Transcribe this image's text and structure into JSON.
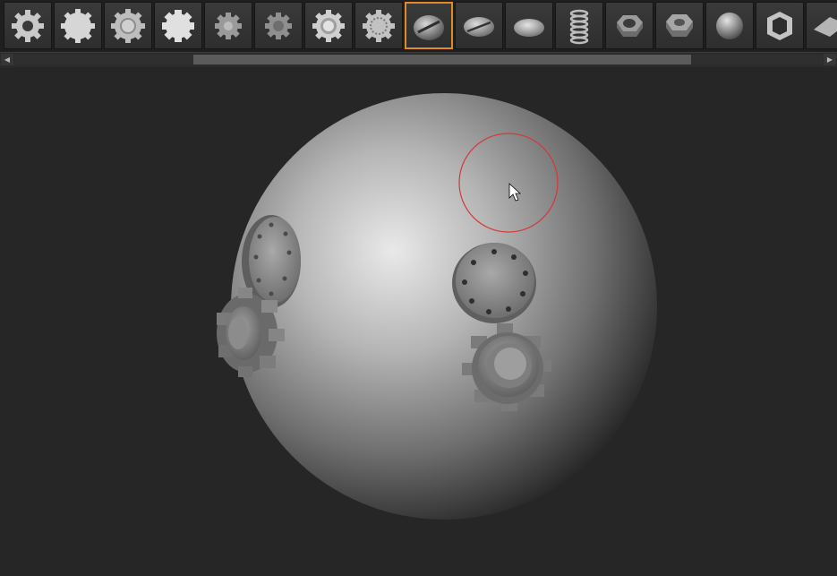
{
  "toolbar": {
    "thumbnails": [
      {
        "icon": "gear-icon"
      },
      {
        "icon": "round-gear-icon"
      },
      {
        "icon": "gear-ring-icon"
      },
      {
        "icon": "spur-gear-icon"
      },
      {
        "icon": "small-gear-icon"
      },
      {
        "icon": "small-gear-2-icon"
      },
      {
        "icon": "gear-hub-icon"
      },
      {
        "icon": "gear-ring-2-icon"
      },
      {
        "icon": "slotted-screw-head-icon",
        "selected": true
      },
      {
        "icon": "slotted-disc-icon"
      },
      {
        "icon": "rivet-icon"
      },
      {
        "icon": "spring-icon"
      },
      {
        "icon": "hex-nut-icon"
      },
      {
        "icon": "hex-nut-2-icon"
      },
      {
        "icon": "dome-bolt-icon"
      },
      {
        "icon": "washer-icon"
      },
      {
        "icon": "wedge-icon"
      }
    ]
  },
  "colors": {
    "accent_selected": "#e08a2a",
    "brush_circle": "#d23a3a",
    "background": "#262626"
  },
  "viewport": {
    "objects": [
      "sphere-mesh",
      "bolt-plate",
      "gear",
      "bolt-plate",
      "gear"
    ]
  }
}
